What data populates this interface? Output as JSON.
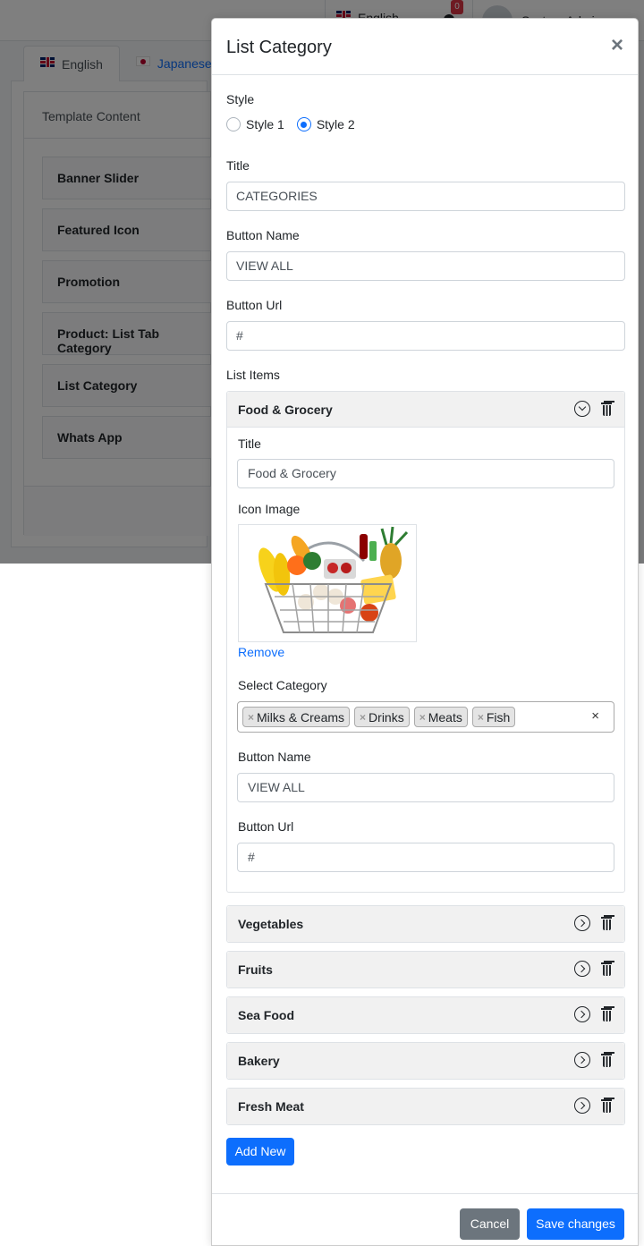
{
  "topbar": {
    "language": "English",
    "notification_count": "0",
    "user_name": "System Admin"
  },
  "tabs": [
    {
      "label": "English",
      "active": true
    },
    {
      "label": "Japanese",
      "active": false
    }
  ],
  "template_content": {
    "header": "Template Content",
    "items": [
      "Banner Slider",
      "Featured Icon",
      "Promotion",
      "Product: List Tab Category",
      "List Category",
      "Whats App"
    ]
  },
  "modal": {
    "title": "List Category",
    "close_label": "×",
    "style": {
      "label": "Style",
      "options": [
        {
          "label": "Style 1",
          "checked": false
        },
        {
          "label": "Style 2",
          "checked": true
        }
      ]
    },
    "title_field": {
      "label": "Title",
      "value": "CATEGORIES"
    },
    "button_name_field": {
      "label": "Button Name",
      "value": "VIEW ALL"
    },
    "button_url_field": {
      "label": "Button Url",
      "value": "#"
    },
    "list_items_label": "List Items",
    "expanded_item": {
      "name": "Food & Grocery",
      "title_label": "Title",
      "title_value": "Food & Grocery",
      "icon_label": "Icon Image",
      "remove_label": "Remove",
      "category_label": "Select Category",
      "categories": [
        "Milks & Creams",
        "Drinks",
        "Meats",
        "Fish"
      ],
      "chip_remove": "×",
      "clear_all": "×",
      "button_name_label": "Button Name",
      "button_name_value": "VIEW ALL",
      "button_url_label": "Button Url",
      "button_url_value": "#"
    },
    "collapsed_items": [
      "Vegetables",
      "Fruits",
      "Sea Food",
      "Bakery",
      "Fresh Meat"
    ],
    "add_new_label": "Add New",
    "cancel_label": "Cancel",
    "save_label": "Save changes"
  },
  "colors": {
    "primary": "#0d6efd",
    "secondary": "#6c757d",
    "accordion_header": "#f1f1f1"
  }
}
